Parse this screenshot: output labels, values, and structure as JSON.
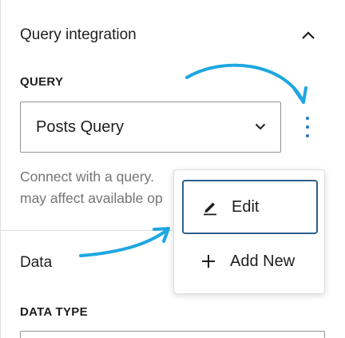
{
  "section": {
    "title": "Query integration",
    "toggle_icon": "chevron-up-icon"
  },
  "query": {
    "label": "QUERY",
    "selected_value": "Posts Query",
    "dropdown_icon": "chevron-down-icon",
    "more_icon": "more-vertical-icon",
    "help_text_line1": "Connect with a query.",
    "help_text_line2": "may affect available op"
  },
  "data": {
    "title": "Data",
    "type_label": "DATA TYPE"
  },
  "menu": {
    "items": [
      {
        "label": "Edit",
        "icon": "pencil-icon"
      },
      {
        "label": "Add New",
        "icon": "plus-icon"
      }
    ]
  },
  "colors": {
    "accent": "#1e79c4",
    "annotation_arrow": "#1ea7e0",
    "focus_border": "#2c5f8a",
    "text": "#1e1e1e",
    "help_text": "#757575"
  }
}
